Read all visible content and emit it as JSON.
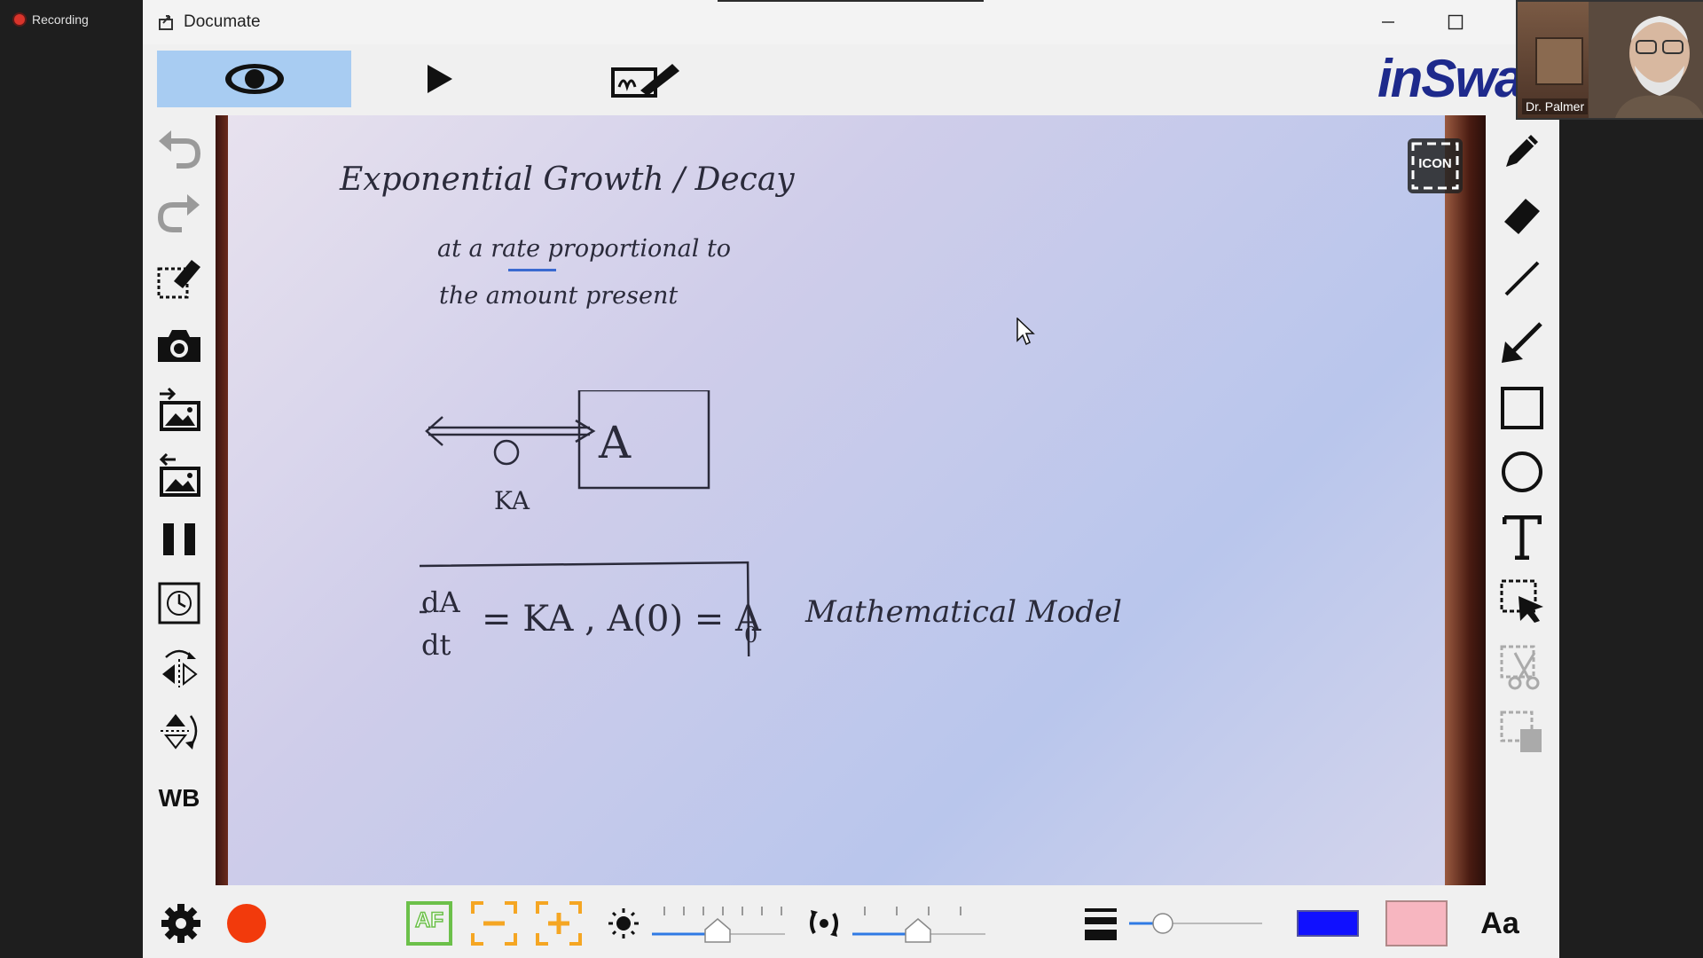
{
  "recording": {
    "label": "Recording"
  },
  "window": {
    "title": "Documate"
  },
  "brand": {
    "text": "inSwar"
  },
  "participant": {
    "name": "Dr. Palmer"
  },
  "left_toolbar": {
    "wb_label": "WB"
  },
  "canvas": {
    "badge": "ICON",
    "title": "Exponential Growth / Decay",
    "line1": "at a rate proportional to",
    "line2": "the amount present",
    "box_label": "A",
    "arrow_label": "KA",
    "eq_numerator": "dA",
    "eq_denominator": "dt",
    "eq_rest": "= KA , A(0) = A",
    "eq_sub": "0",
    "model_label": "Mathematical Model"
  },
  "bottom_toolbar": {
    "af_label": "AF",
    "font_label": "Aa",
    "colors": {
      "record": "#f23a0c",
      "line_color": "#1010ff",
      "fill_color": "#f7b6c0"
    }
  }
}
